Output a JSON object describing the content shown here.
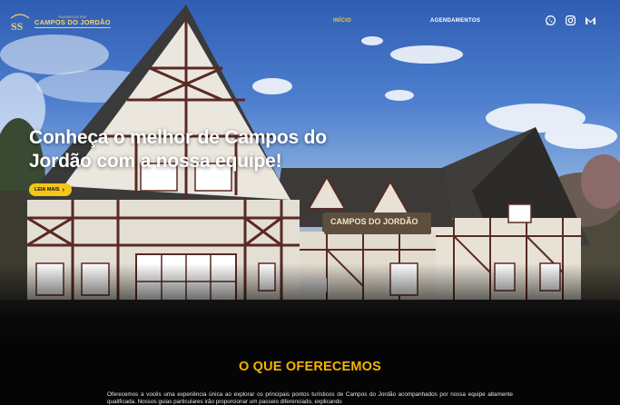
{
  "header": {
    "logo": {
      "small_text": "PASSEIOS EM",
      "big_text": "CAMPOS DO JORDÃO"
    },
    "nav": [
      {
        "label": "INÍCIO",
        "active": true
      },
      {
        "label": "AGENDAMENTOS",
        "active": false
      }
    ],
    "social": [
      {
        "icon": "whatsapp-icon"
      },
      {
        "icon": "instagram-icon"
      },
      {
        "icon": "mail-icon"
      }
    ]
  },
  "hero": {
    "title": "Conheça o melhor de Campos do Jordão com a nossa equipe!",
    "cta_label": "LEIA MAIS",
    "cta_icon": "›",
    "building_sign": "CAMPOS DO JORDÃO"
  },
  "section": {
    "title": "O QUE OFERECEMOS",
    "text": "Oferecemos a vocês uma experiência única ao explorar os principais pontos turísticos de Campos do Jordão acompanhados por nossa equipe altamente qualificada. Nossos guias particulares irão proporcionar um passeio diferenciado, explicando"
  },
  "colors": {
    "accent": "#f5c518",
    "section_title": "#f5b400",
    "nav_active": "#f5c842",
    "background": "#050505"
  }
}
